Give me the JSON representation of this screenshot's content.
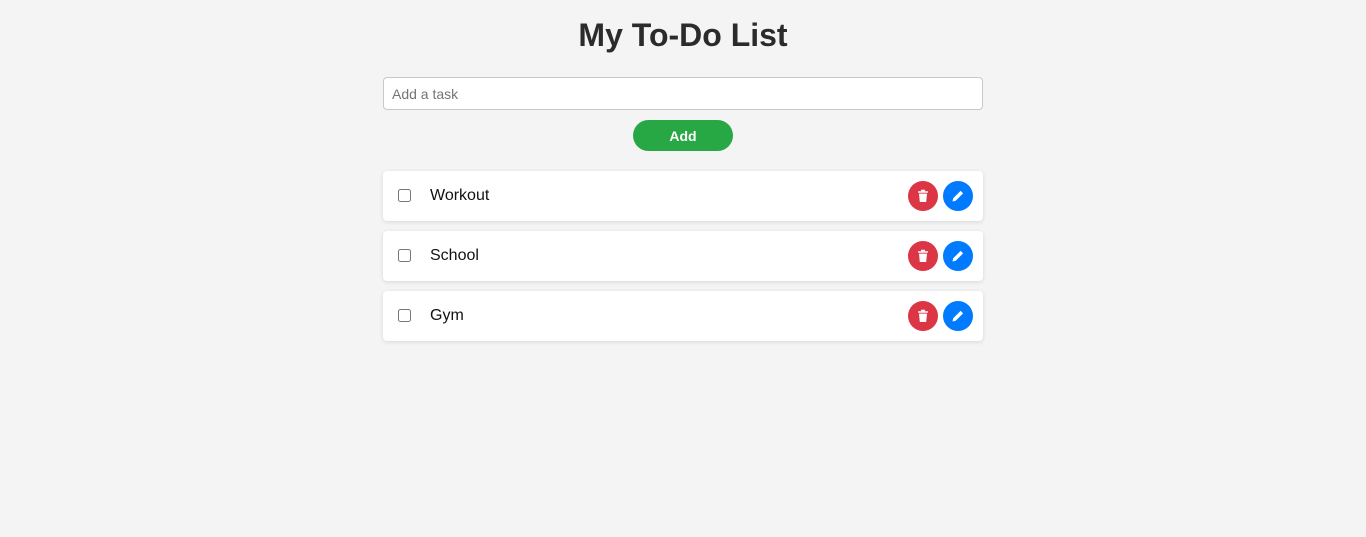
{
  "page": {
    "title": "My To-Do List"
  },
  "input": {
    "placeholder": "Add a task",
    "value": ""
  },
  "add_button": {
    "label": "Add"
  },
  "tasks": [
    {
      "label": "Workout",
      "checked": false
    },
    {
      "label": "School",
      "checked": false
    },
    {
      "label": "Gym",
      "checked": false
    }
  ],
  "icons": {
    "delete": "trash-icon",
    "edit": "pencil-icon"
  },
  "colors": {
    "background": "#f4f4f4",
    "add_button": "#28a745",
    "delete_button": "#dc3545",
    "edit_button": "#007bff",
    "title": "#2b2b2b"
  }
}
